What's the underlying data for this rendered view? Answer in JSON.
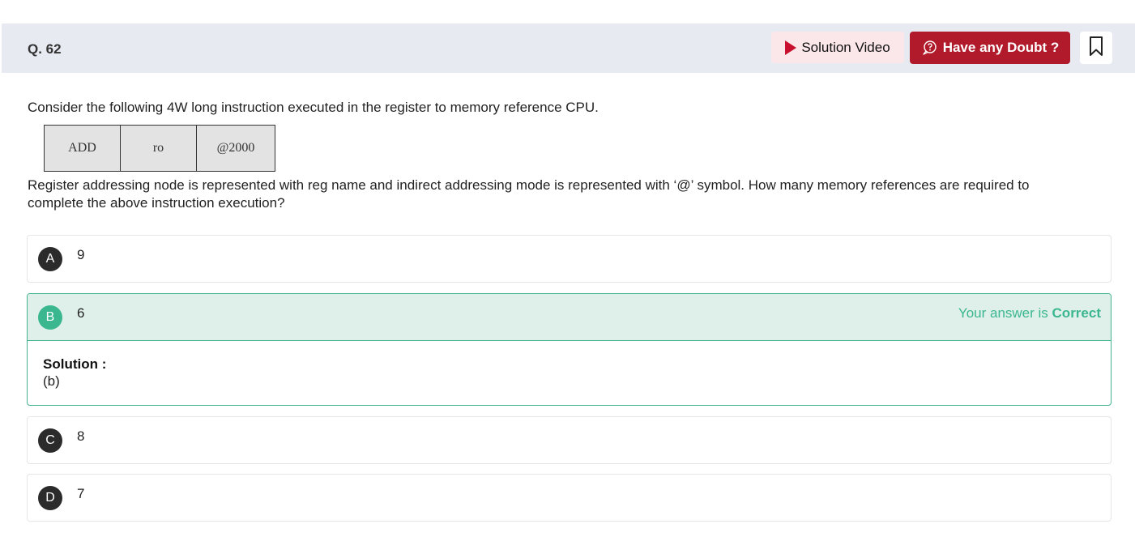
{
  "header": {
    "question_number": "Q. 62",
    "solution_video_label": "Solution Video",
    "doubt_label": "Have any Doubt ?",
    "accent_color": "#b01a2a"
  },
  "question": {
    "text_1": "Consider the following 4W long instruction executed in the register to memory reference CPU.",
    "instruction_fields": [
      "ADD",
      "ro",
      "@2000"
    ],
    "text_2": "Register addressing node is represented with reg name and indirect addressing mode is represented with ‘@’ symbol. How many memory references are required to complete the above instruction execution?"
  },
  "options": [
    {
      "letter": "A",
      "text": "9"
    },
    {
      "letter": "B",
      "text": "6"
    },
    {
      "letter": "C",
      "text": "8"
    },
    {
      "letter": "D",
      "text": "7"
    }
  ],
  "result": {
    "prefix": "Your answer is ",
    "status": "Correct",
    "color": "#3bb78f"
  },
  "solution": {
    "label": "Solution :",
    "text": "(b)"
  }
}
